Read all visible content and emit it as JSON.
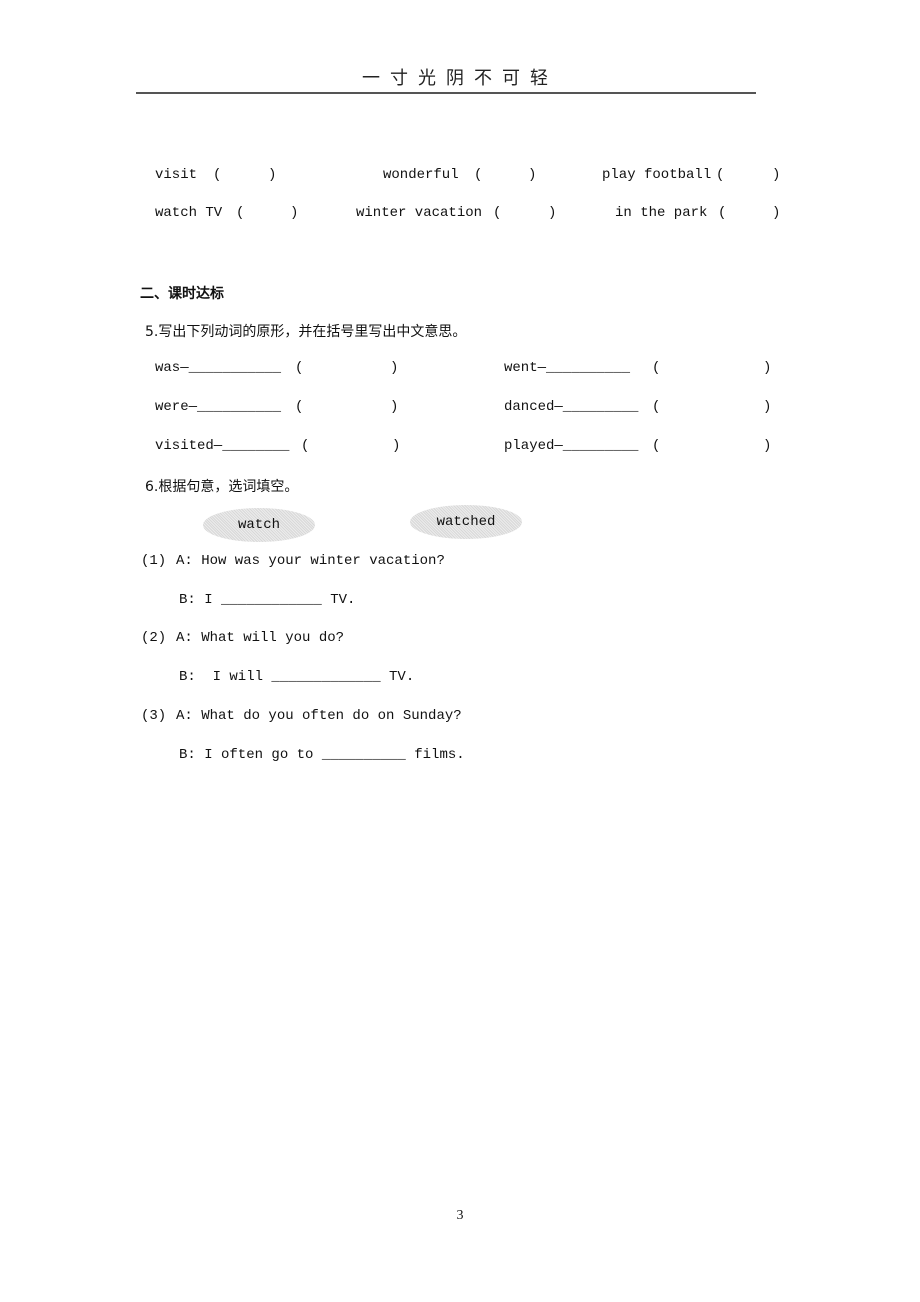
{
  "header": {
    "title": "一寸光阴不可轻"
  },
  "vocab_rows": [
    [
      {
        "word": "visit",
        "bracket_open": "(",
        "bracket_close": ")"
      },
      {
        "word": "wonderful",
        "bracket_open": "(",
        "bracket_close": ")"
      },
      {
        "word": "play football",
        "bracket_open": "(",
        "bracket_close": ")"
      }
    ],
    [
      {
        "word": "watch TV",
        "bracket_open": "(",
        "bracket_close": ")"
      },
      {
        "word": "winter vacation",
        "bracket_open": "(",
        "bracket_close": ")"
      },
      {
        "word": "in the park",
        "bracket_open": "(",
        "bracket_close": ")"
      }
    ]
  ],
  "section2": {
    "heading": "二、课时达标",
    "q5": {
      "instruction": "5.写出下列动词的原形，并在括号里写出中文意思。",
      "items": [
        {
          "word": "was—___________",
          "open": "(",
          "close": ")"
        },
        {
          "word": "went—__________",
          "open": "(",
          "close": ")"
        },
        {
          "word": "were—__________",
          "open": "(",
          "close": ")"
        },
        {
          "word": "danced—_________",
          "open": "(",
          "close": ")"
        },
        {
          "word": "visited—________",
          "open": "(",
          "close": ")"
        },
        {
          "word": "played—_________",
          "open": "(",
          "close": ")"
        }
      ]
    },
    "q6": {
      "instruction": "6.根据句意，选词填空。",
      "word_bank": [
        "watch",
        "watched"
      ],
      "dialogues": [
        {
          "num": "(1)",
          "a": "A: How was your winter vacation?",
          "b": "B: I ____________ TV."
        },
        {
          "num": "(2)",
          "a": "A: What will you do?",
          "b": "B:  I will _____________ TV."
        },
        {
          "num": "(3)",
          "a": "A: What do you often do on Sunday?",
          "b": "B: I often go to __________ films."
        }
      ]
    }
  },
  "footer": {
    "page_number": "3"
  }
}
